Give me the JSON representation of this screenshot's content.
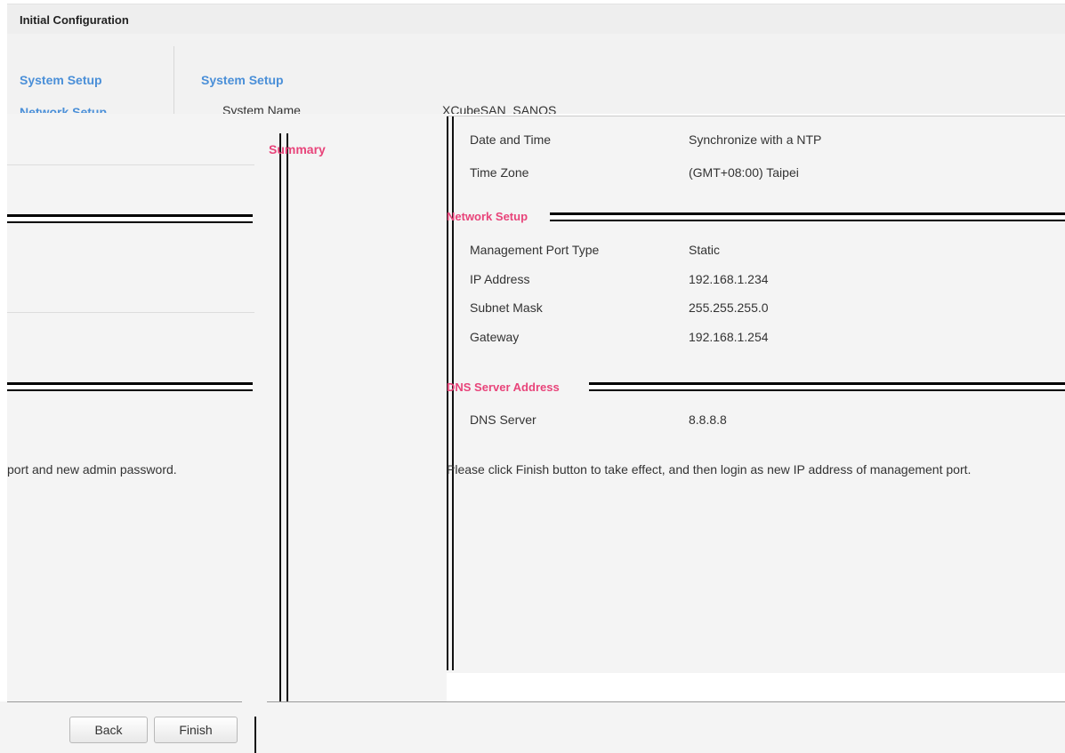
{
  "window": {
    "title": "Initial Configuration"
  },
  "back_window": {
    "sidebar": {
      "system_setup": "System Setup",
      "network_setup": "Network Setup"
    },
    "main": {
      "heading": "System Setup",
      "system_name_label": "System Name",
      "system_name_value": "XCubeSAN_SANOS"
    }
  },
  "wizard": {
    "instruction": "port and new admin password."
  },
  "summary": {
    "heading": "Summary",
    "system_rows": [
      {
        "label": "Date and Time",
        "value": "Synchronize with a NTP"
      },
      {
        "label": "Time Zone",
        "value": "(GMT+08:00) Taipei"
      }
    ],
    "network_section_title": "Network Setup",
    "network_rows": [
      {
        "label": "Management Port Type",
        "value": "Static"
      },
      {
        "label": "IP Address",
        "value": "192.168.1.234"
      },
      {
        "label": "Subnet Mask",
        "value": "255.255.255.0"
      },
      {
        "label": "Gateway",
        "value": "192.168.1.254"
      }
    ],
    "dns_section_title": "DNS Server Address",
    "dns_rows": [
      {
        "label": "DNS Server",
        "value": "8.8.8.8"
      }
    ],
    "note": "Please click Finish button to take effect, and then login as new IP address of management port."
  },
  "footer": {
    "back_label": "Back",
    "finish_label": "Finish"
  },
  "colors": {
    "accent_blue": "#4a8fd8",
    "accent_pink": "#e8447a"
  }
}
